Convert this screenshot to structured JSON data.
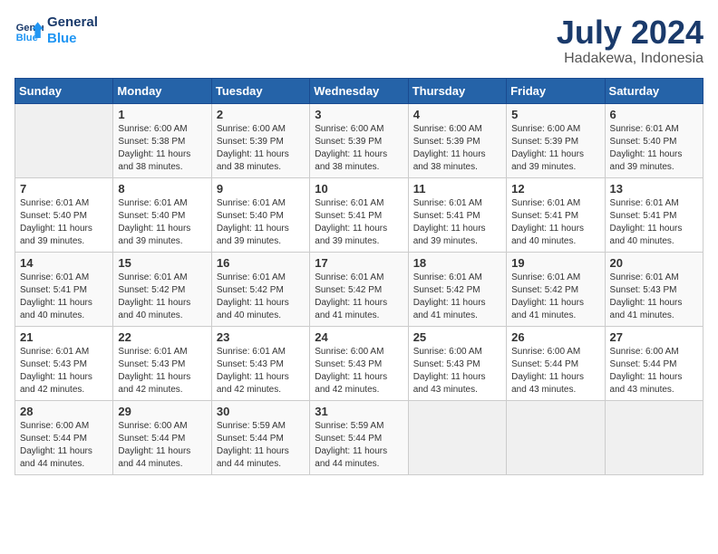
{
  "header": {
    "logo_line1": "General",
    "logo_line2": "Blue",
    "month": "July 2024",
    "location": "Hadakewa, Indonesia"
  },
  "weekdays": [
    "Sunday",
    "Monday",
    "Tuesday",
    "Wednesday",
    "Thursday",
    "Friday",
    "Saturday"
  ],
  "weeks": [
    [
      {
        "day": "",
        "empty": true
      },
      {
        "day": "1",
        "sunrise": "6:00 AM",
        "sunset": "5:38 PM",
        "daylight": "11 hours and 38 minutes."
      },
      {
        "day": "2",
        "sunrise": "6:00 AM",
        "sunset": "5:39 PM",
        "daylight": "11 hours and 38 minutes."
      },
      {
        "day": "3",
        "sunrise": "6:00 AM",
        "sunset": "5:39 PM",
        "daylight": "11 hours and 38 minutes."
      },
      {
        "day": "4",
        "sunrise": "6:00 AM",
        "sunset": "5:39 PM",
        "daylight": "11 hours and 38 minutes."
      },
      {
        "day": "5",
        "sunrise": "6:00 AM",
        "sunset": "5:39 PM",
        "daylight": "11 hours and 39 minutes."
      },
      {
        "day": "6",
        "sunrise": "6:01 AM",
        "sunset": "5:40 PM",
        "daylight": "11 hours and 39 minutes."
      }
    ],
    [
      {
        "day": "7",
        "sunrise": "6:01 AM",
        "sunset": "5:40 PM",
        "daylight": "11 hours and 39 minutes."
      },
      {
        "day": "8",
        "sunrise": "6:01 AM",
        "sunset": "5:40 PM",
        "daylight": "11 hours and 39 minutes."
      },
      {
        "day": "9",
        "sunrise": "6:01 AM",
        "sunset": "5:40 PM",
        "daylight": "11 hours and 39 minutes."
      },
      {
        "day": "10",
        "sunrise": "6:01 AM",
        "sunset": "5:41 PM",
        "daylight": "11 hours and 39 minutes."
      },
      {
        "day": "11",
        "sunrise": "6:01 AM",
        "sunset": "5:41 PM",
        "daylight": "11 hours and 39 minutes."
      },
      {
        "day": "12",
        "sunrise": "6:01 AM",
        "sunset": "5:41 PM",
        "daylight": "11 hours and 40 minutes."
      },
      {
        "day": "13",
        "sunrise": "6:01 AM",
        "sunset": "5:41 PM",
        "daylight": "11 hours and 40 minutes."
      }
    ],
    [
      {
        "day": "14",
        "sunrise": "6:01 AM",
        "sunset": "5:41 PM",
        "daylight": "11 hours and 40 minutes."
      },
      {
        "day": "15",
        "sunrise": "6:01 AM",
        "sunset": "5:42 PM",
        "daylight": "11 hours and 40 minutes."
      },
      {
        "day": "16",
        "sunrise": "6:01 AM",
        "sunset": "5:42 PM",
        "daylight": "11 hours and 40 minutes."
      },
      {
        "day": "17",
        "sunrise": "6:01 AM",
        "sunset": "5:42 PM",
        "daylight": "11 hours and 41 minutes."
      },
      {
        "day": "18",
        "sunrise": "6:01 AM",
        "sunset": "5:42 PM",
        "daylight": "11 hours and 41 minutes."
      },
      {
        "day": "19",
        "sunrise": "6:01 AM",
        "sunset": "5:42 PM",
        "daylight": "11 hours and 41 minutes."
      },
      {
        "day": "20",
        "sunrise": "6:01 AM",
        "sunset": "5:43 PM",
        "daylight": "11 hours and 41 minutes."
      }
    ],
    [
      {
        "day": "21",
        "sunrise": "6:01 AM",
        "sunset": "5:43 PM",
        "daylight": "11 hours and 42 minutes."
      },
      {
        "day": "22",
        "sunrise": "6:01 AM",
        "sunset": "5:43 PM",
        "daylight": "11 hours and 42 minutes."
      },
      {
        "day": "23",
        "sunrise": "6:01 AM",
        "sunset": "5:43 PM",
        "daylight": "11 hours and 42 minutes."
      },
      {
        "day": "24",
        "sunrise": "6:00 AM",
        "sunset": "5:43 PM",
        "daylight": "11 hours and 42 minutes."
      },
      {
        "day": "25",
        "sunrise": "6:00 AM",
        "sunset": "5:43 PM",
        "daylight": "11 hours and 43 minutes."
      },
      {
        "day": "26",
        "sunrise": "6:00 AM",
        "sunset": "5:44 PM",
        "daylight": "11 hours and 43 minutes."
      },
      {
        "day": "27",
        "sunrise": "6:00 AM",
        "sunset": "5:44 PM",
        "daylight": "11 hours and 43 minutes."
      }
    ],
    [
      {
        "day": "28",
        "sunrise": "6:00 AM",
        "sunset": "5:44 PM",
        "daylight": "11 hours and 44 minutes."
      },
      {
        "day": "29",
        "sunrise": "6:00 AM",
        "sunset": "5:44 PM",
        "daylight": "11 hours and 44 minutes."
      },
      {
        "day": "30",
        "sunrise": "5:59 AM",
        "sunset": "5:44 PM",
        "daylight": "11 hours and 44 minutes."
      },
      {
        "day": "31",
        "sunrise": "5:59 AM",
        "sunset": "5:44 PM",
        "daylight": "11 hours and 44 minutes."
      },
      {
        "day": "",
        "empty": true
      },
      {
        "day": "",
        "empty": true
      },
      {
        "day": "",
        "empty": true
      }
    ]
  ]
}
